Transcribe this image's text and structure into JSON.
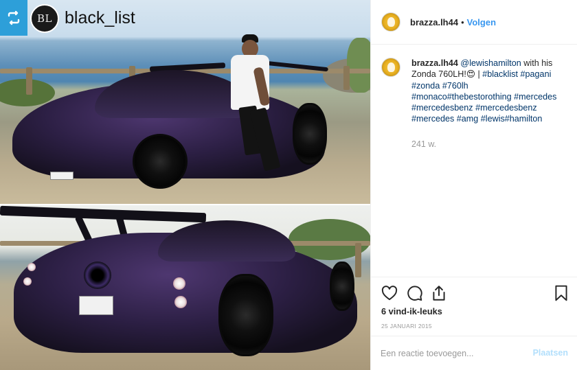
{
  "overlay": {
    "logo_text": "BL",
    "brand_name": "black_list",
    "repost_icon": "repost-icon"
  },
  "header": {
    "username": "brazza.lh44",
    "separator": "•",
    "follow_label": "Volgen"
  },
  "caption": {
    "username": "brazza.lh44",
    "mention": "@lewishamilton",
    "text_before_tags": " with his Zonda 760LH!",
    "emoji": "😍",
    "divider": " | ",
    "tags_line1": "#blacklist #pagani",
    "tags_line2": "#zonda #760lh",
    "tags_line3": "#monaco#thebestorothing #mercedes",
    "tags_line4": "#mercedesbenz #mercedesbenz",
    "tags_line5": "#mercedes #amg #lewis#hamilton",
    "time": "241 w."
  },
  "actions": {
    "like_icon": "heart-icon",
    "comment_icon": "comment-icon",
    "share_icon": "share-icon",
    "save_icon": "bookmark-icon",
    "likes": "6 vind-ik-leuks",
    "date": "25 JANUARI 2015"
  },
  "comment_box": {
    "placeholder": "Een reactie toevoegen...",
    "post_label": "Plaatsen"
  },
  "colors": {
    "link_blue": "#3897f0",
    "hashtag": "#003569",
    "muted": "#999999",
    "repost_badge": "#2d9fd9",
    "post_button_disabled": "#b2dffc"
  }
}
